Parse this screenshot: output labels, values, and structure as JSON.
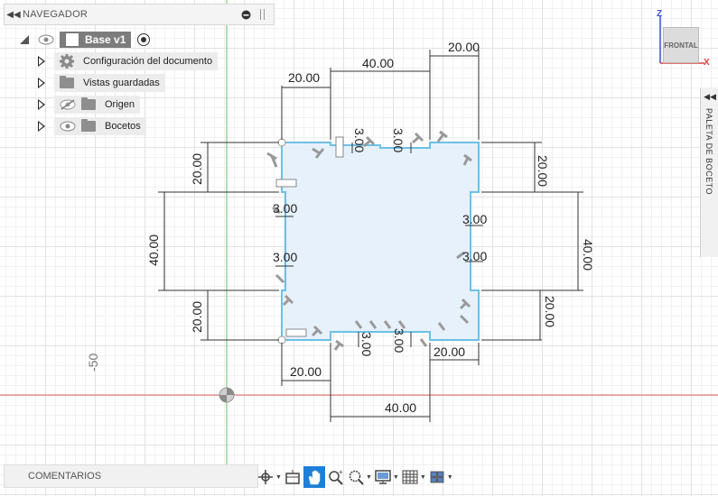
{
  "navigator": {
    "title": "NAVEGADOR",
    "root": {
      "label": "Base v1"
    },
    "items": [
      {
        "label": "Configuración del documento",
        "icon": "gear-icon"
      },
      {
        "label": "Vistas guardadas",
        "icon": "folder-icon"
      },
      {
        "label": "Origen",
        "icon": "folder-icon",
        "visibility": "hidden"
      },
      {
        "label": "Bocetos",
        "icon": "folder-icon",
        "visibility": "visible"
      }
    ]
  },
  "viewcube": {
    "face": "FRONTAL",
    "z_label": "Z",
    "x_label": "X"
  },
  "sketch_palette": {
    "label": "PALETA DE BOCETO"
  },
  "comments": {
    "label": "COMENTARIOS"
  },
  "axis_value": "-50",
  "dimensions": {
    "top_left": "20.00",
    "top_middle": "40.00",
    "top_right": "20.00",
    "left_top": "20.00",
    "left_middle": "40.00",
    "left_bottom": "20.00",
    "right_top": "20.00",
    "right_middle": "40.00",
    "right_bottom": "20.00",
    "bottom_left": "20.00",
    "bottom_middle": "40.00",
    "bottom_right": "20.00",
    "notch_top_left": "3.00",
    "notch_top_right": "3.00",
    "notch_left_top": "3.00",
    "notch_left_bottom": "3.00",
    "notch_right_top": "3.00",
    "notch_right_bottom": "3.00",
    "notch_bottom_left": "3.00",
    "notch_bottom_right": "3.00"
  },
  "colors": {
    "sketch_line": "#6cc0e6",
    "sketch_fill": "#e6f1fb",
    "x_axis": "#e06060",
    "y_axis": "#62c462",
    "toolbar_active": "#1d7fd8"
  }
}
